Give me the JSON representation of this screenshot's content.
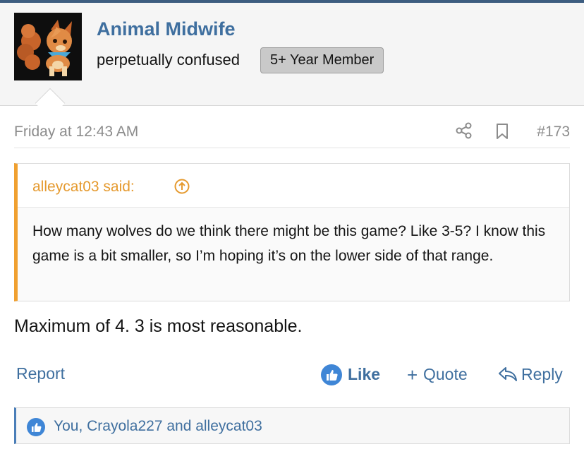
{
  "author": {
    "name": "Animal Midwife",
    "title": "perpetually confused",
    "badge": "5+ Year Member"
  },
  "post": {
    "date": "Friday at 12:43 AM",
    "number": "#173",
    "quote": {
      "author": "alleycat03 said:",
      "text": "How many wolves do we think there might be this game? Like 3-5? I know this game is a bit smaller, so I’m hoping it’s on the lower side of that range."
    },
    "message": "Maximum of 4. 3 is most reasonable."
  },
  "actions": {
    "report": "Report",
    "like": "Like",
    "quote_plus": "+",
    "quote": "Quote",
    "reply": "Reply"
  },
  "reactions": {
    "text": "You, Crayola227 and alleycat03"
  },
  "colors": {
    "link": "#3f6f9f",
    "quote_accent": "#f0a030",
    "reaction_accent": "#4a7eb8"
  }
}
